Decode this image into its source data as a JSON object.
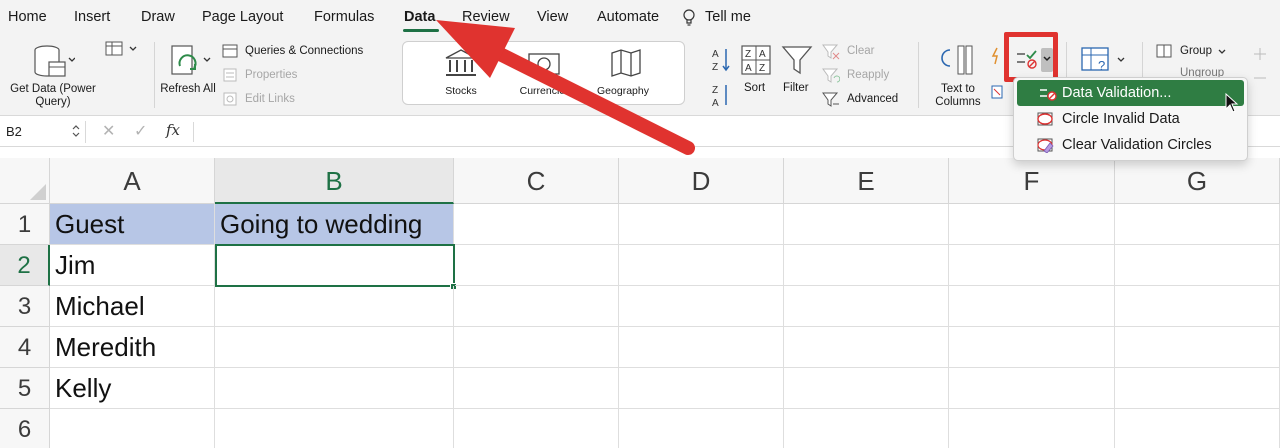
{
  "tabs": [
    "Home",
    "Insert",
    "Draw",
    "Page Layout",
    "Formulas",
    "Data",
    "Review",
    "View",
    "Automate",
    "Tell me"
  ],
  "active_tab": "Data",
  "ribbon": {
    "get_data": "Get Data (Power Query)",
    "refresh_all": "Refresh All",
    "queries_connections": "Queries & Connections",
    "properties": "Properties",
    "edit_links": "Edit Links",
    "stocks": "Stocks",
    "currencies": "Currencies",
    "geography": "Geography",
    "sort": "Sort",
    "filter": "Filter",
    "clear": "Clear",
    "reapply": "Reapply",
    "advanced": "Advanced",
    "text_to_columns": "Text to Columns",
    "group": "Group",
    "ungroup": "Ungroup"
  },
  "formula_bar": {
    "name_box": "B2",
    "formula": ""
  },
  "columns": [
    "A",
    "B",
    "C",
    "D",
    "E",
    "F",
    "G"
  ],
  "selected_column": "B",
  "rows": [
    "1",
    "2",
    "3",
    "4",
    "5",
    "6"
  ],
  "selected_row": "2",
  "cells": {
    "A1": "Guest",
    "B1": "Going to wedding",
    "A2": "Jim",
    "A3": "Michael",
    "A4": "Meredith",
    "A5": "Kelly"
  },
  "dropdown": {
    "items": [
      "Data Validation...",
      "Circle Invalid Data",
      "Clear Validation Circles"
    ],
    "active_item": "Data Validation..."
  },
  "colors": {
    "accent": "#1e7145",
    "header_fill": "#b7c6e6",
    "annotation": "#e0332f",
    "menu_highlight": "#2f7d43"
  }
}
